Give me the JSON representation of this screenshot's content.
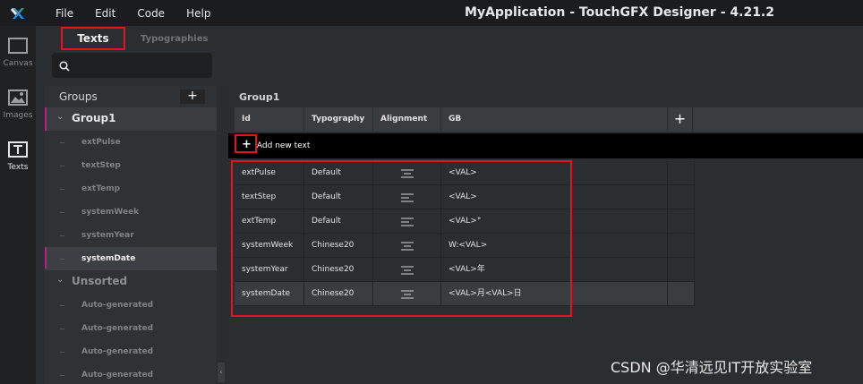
{
  "window": {
    "title": "MyApplication - TouchGFX Designer - 4.21.2",
    "menu": [
      "File",
      "Edit",
      "Code",
      "Help"
    ]
  },
  "rail": [
    {
      "label": "Canvas",
      "icon": "canvas-icon"
    },
    {
      "label": "Images",
      "icon": "images-icon"
    },
    {
      "label": "Texts",
      "icon": "texts-icon",
      "active": true
    }
  ],
  "tabs": {
    "texts": "Texts",
    "typographies": "Typographies"
  },
  "search": {
    "placeholder": ""
  },
  "groups": {
    "title": "Groups",
    "add": "+",
    "tree": [
      {
        "label": "Group1",
        "kind": "group",
        "expanded": true
      },
      {
        "label": "extPulse"
      },
      {
        "label": "textStep"
      },
      {
        "label": "extTemp"
      },
      {
        "label": "systemWeek"
      },
      {
        "label": "systemYear"
      },
      {
        "label": "systemDate",
        "selected": true
      },
      {
        "label": "Unsorted",
        "kind": "group2",
        "expanded": true
      },
      {
        "label": "Auto-generated"
      },
      {
        "label": "Auto-generated"
      },
      {
        "label": "Auto-generated"
      },
      {
        "label": "Auto-generated"
      }
    ]
  },
  "table": {
    "group_title": "Group1",
    "columns": [
      "Id",
      "Typography",
      "Alignment",
      "GB"
    ],
    "add_column": "+",
    "add_text": "Add new text",
    "rows": [
      {
        "id": "extPulse",
        "typography": "Default",
        "alignment": "center",
        "gb": "<VAL>"
      },
      {
        "id": "textStep",
        "typography": "Default",
        "alignment": "left",
        "gb": "<VAL>"
      },
      {
        "id": "extTemp",
        "typography": "Default",
        "alignment": "left",
        "gb": "<VAL>°"
      },
      {
        "id": "systemWeek",
        "typography": "Chinese20",
        "alignment": "center",
        "gb": "W:<VAL>"
      },
      {
        "id": "systemYear",
        "typography": "Chinese20",
        "alignment": "center",
        "gb": "<VAL>年"
      },
      {
        "id": "systemDate",
        "typography": "Chinese20",
        "alignment": "center",
        "gb": "<VAL>月<VAL>日"
      }
    ]
  },
  "watermark": "CSDN @华清远见IT开放实验室",
  "colors": {
    "highlight": "#e0161e",
    "selection_marker": "#c21c8c",
    "background": "#2b2e31",
    "titlebar": "#1a1c1e"
  }
}
